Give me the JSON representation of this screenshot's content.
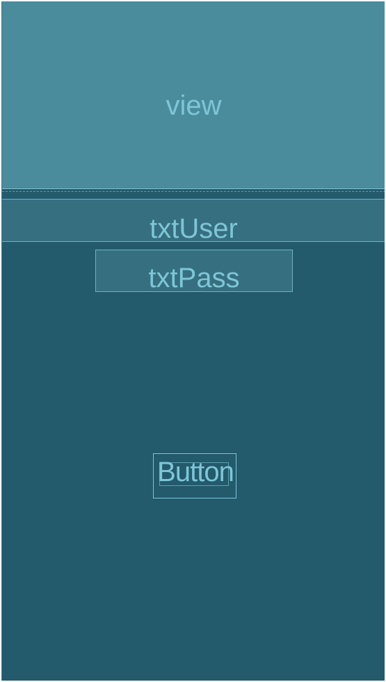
{
  "layout": {
    "view": {
      "label": "view"
    },
    "txtUser": {
      "label": "txtUser"
    },
    "txtPass": {
      "label": "txtPass"
    },
    "button": {
      "label": "Button"
    }
  },
  "colors": {
    "background": "#235a6c",
    "view_fill": "#4a8b9c",
    "field_fill": "#366f80",
    "text": "#7ec6d6",
    "outline": "#6fb2c2"
  }
}
